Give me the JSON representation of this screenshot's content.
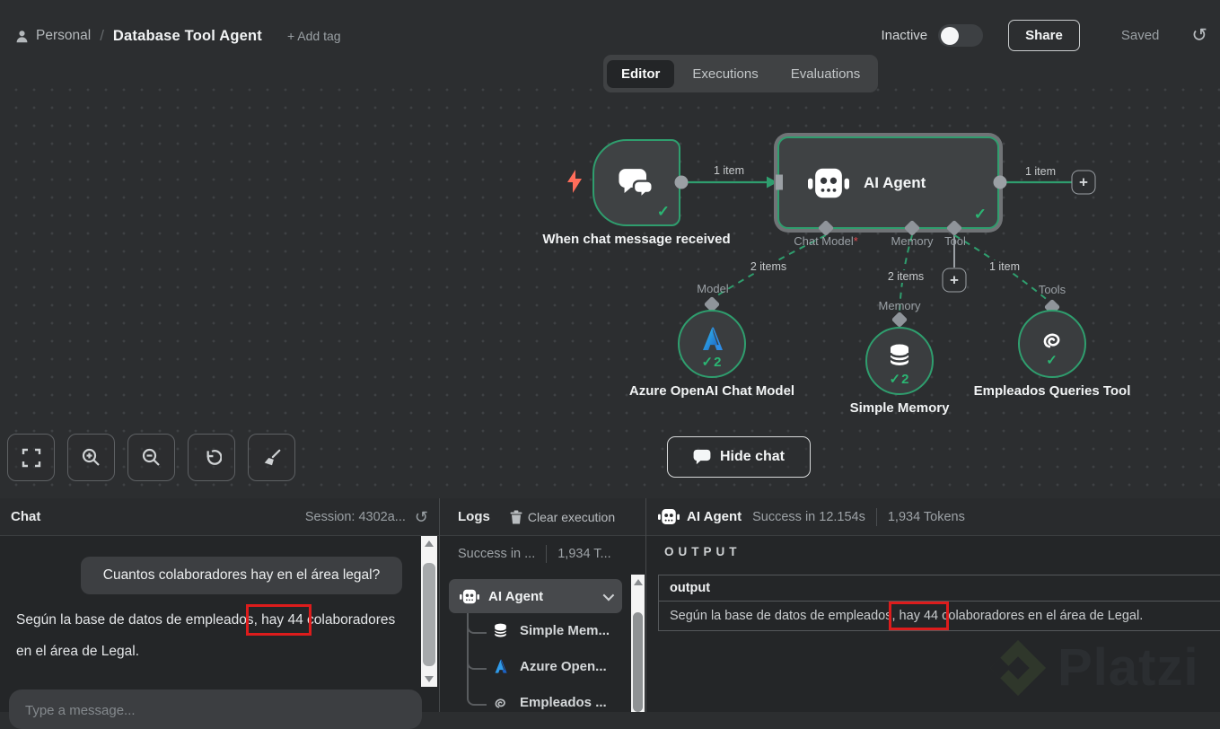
{
  "header": {
    "project": "Personal",
    "separator": "/",
    "title": "Database Tool Agent",
    "add_tag": "+ Add tag",
    "activation": "Inactive",
    "share": "Share",
    "saved": "Saved"
  },
  "tabs": {
    "editor": "Editor",
    "executions": "Executions",
    "evaluations": "Evaluations"
  },
  "canvas": {
    "trigger_name": "When chat message received",
    "agent_name": "AI Agent",
    "agent_ports": {
      "chat_model": "Chat Model",
      "required_marker": "*",
      "memory": "Memory",
      "tool": "Tool"
    },
    "sub_ports": {
      "model": "Model",
      "memory": "Memory",
      "tools": "Tools"
    },
    "edge_labels": {
      "trigger_to_agent": "1 item",
      "agent_output": "1 item",
      "chat_model": "2 items",
      "memory": "2 items",
      "tool": "1 item"
    },
    "subnodes": {
      "chat_model": {
        "name": "Azure OpenAI Chat Model",
        "runs": "2"
      },
      "memory": {
        "name": "Simple Memory",
        "runs": "2"
      },
      "tool": {
        "name": "Empleados Queries Tool"
      }
    },
    "hide_chat": "Hide chat"
  },
  "chat": {
    "title": "Chat",
    "session": "Session: 4302a...",
    "user_message": "Cuantos colaboradores hay en el área legal?",
    "bot_message": {
      "before": "Según la base de datos de empleados",
      "highlight": ", hay 44",
      "after": " colaboradores en el área de Legal."
    },
    "input_placeholder": "Type a message..."
  },
  "logs": {
    "title": "Logs",
    "clear": "Clear execution",
    "summary_status": "Success in ...",
    "summary_tokens": "1,934 T...",
    "tree": {
      "root": "AI Agent",
      "children": [
        "Simple Mem...",
        "Azure Open...",
        "Empleados ..."
      ]
    }
  },
  "output": {
    "node": "AI Agent",
    "status": "Success in 12.154s",
    "tokens": "1,934 Tokens",
    "section": "OUTPUT",
    "column": "output",
    "row": {
      "before": "Según la base de datos de empleados,",
      "highlight": " hay 44 ",
      "after": "colaboradores en el área de Legal."
    }
  },
  "watermark": "Platzi",
  "colors": {
    "accent_green": "#2f9e6e",
    "highlight_red": "#dd1c1c",
    "azure_blue": "#2e8de5",
    "selection_gray": "#707376"
  }
}
